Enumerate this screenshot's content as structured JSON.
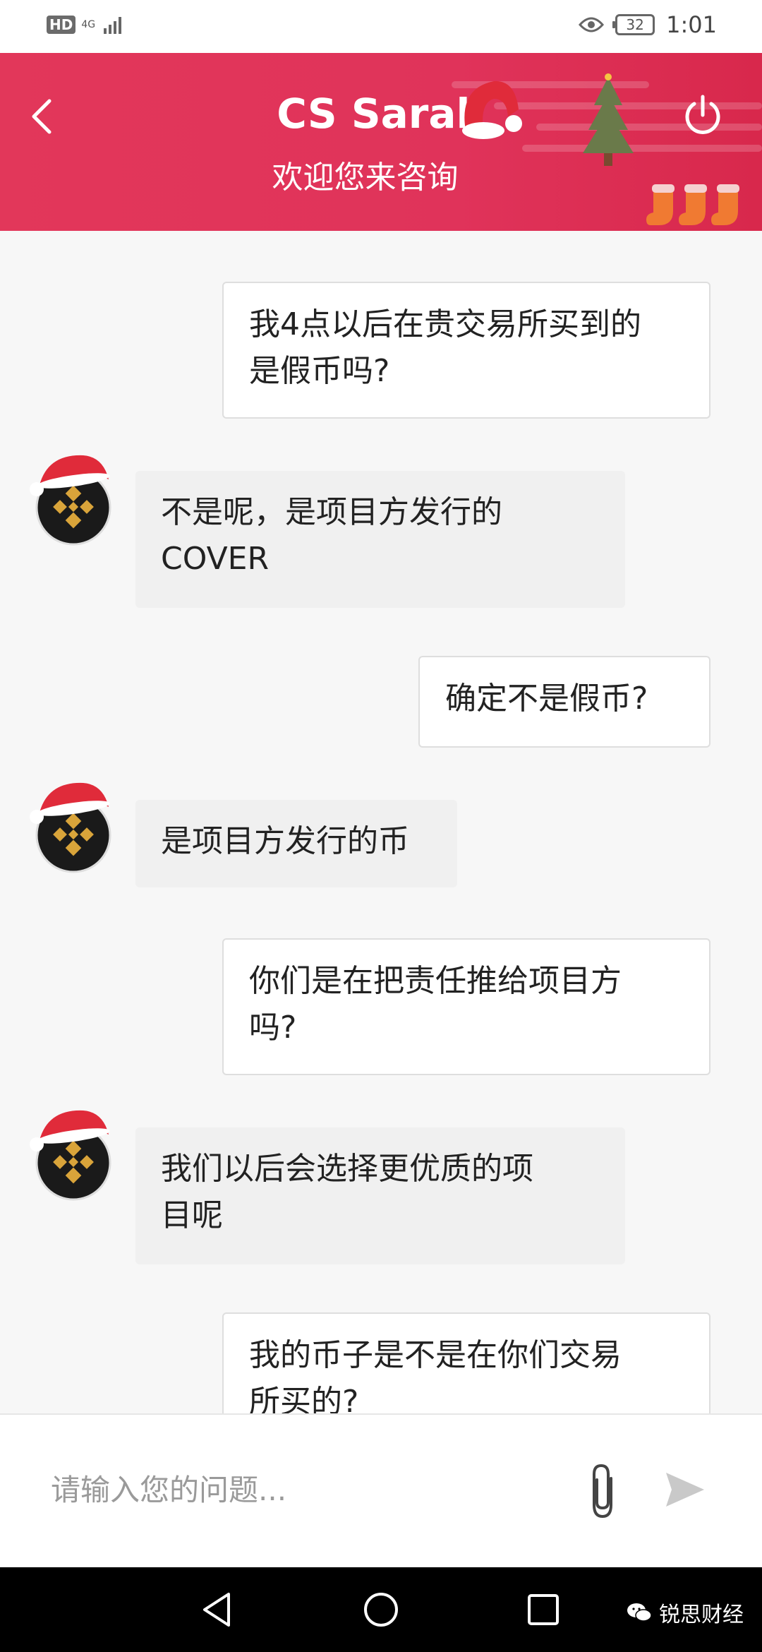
{
  "status_bar": {
    "hd": "HD",
    "network": "4G",
    "battery": "32",
    "time": "1:01"
  },
  "header": {
    "agent_name": "CS Sarah",
    "subtitle": "欢迎您来咨询",
    "accent_color": "#e2375a"
  },
  "chat": {
    "messages": [
      {
        "from": "user",
        "text": "我4点以后在贵交易所买到的\n是假币吗?"
      },
      {
        "from": "agent",
        "text": "不是呢，是项目方发行的\nCOVER"
      },
      {
        "from": "user",
        "text": "确定不是假币?"
      },
      {
        "from": "agent",
        "text": "是项目方发行的币"
      },
      {
        "from": "user",
        "text": "你们是在把责任推给项目方\n吗?"
      },
      {
        "from": "agent",
        "text": "我们以后会选择更优质的项\n目呢"
      },
      {
        "from": "user",
        "text": "我的币子是不是在你们交易\n所买的?"
      }
    ]
  },
  "input": {
    "placeholder": "请输入您的问题..."
  },
  "icons": {
    "back": "chevron-left-icon",
    "power": "power-icon",
    "attach": "paperclip-icon",
    "send": "send-icon"
  },
  "watermark": {
    "text": "锐思财经"
  }
}
